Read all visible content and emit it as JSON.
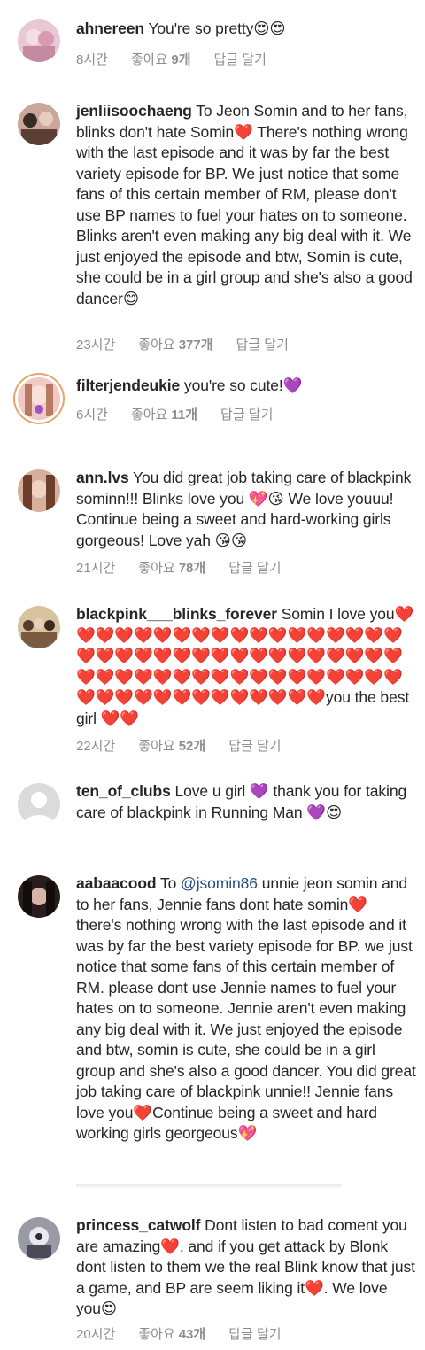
{
  "comments": [
    {
      "username": "ahnereen",
      "text": " You're so pretty😍😍",
      "time": "8시간",
      "likes_label": "좋아요",
      "likes": "9개",
      "reply": "답글 달기"
    },
    {
      "username": "jenliisoochaeng",
      "text": " To Jeon Somin and to her fans, blinks don't hate Somin❤️ There's nothing wrong with the last episode and it was by far the best variety episode for BP. We just notice that some fans of this certain member of RM, please don't use BP names to fuel your hates on to someone. Blinks aren't even making any big deal with it. We just enjoyed the episode and btw, Somin is cute, she could be in a girl group and she's also a good dancer😊",
      "time": "23시간",
      "likes_label": "좋아요",
      "likes": "377개",
      "reply": "답글 달기"
    },
    {
      "username": "filterjendeukie",
      "text": " you're so cute!💜",
      "time": "6시간",
      "likes_label": "좋아요",
      "likes": "11개",
      "reply": "답글 달기"
    },
    {
      "username": "ann.lvs",
      "text": " You did great job taking care of blackpink sominn!!! Blinks love you 💖😘 We love youuu! Continue being a sweet and hard-working girls gorgeous! Love yah 😘😘",
      "time": "21시간",
      "likes_label": "좋아요",
      "likes": "78개",
      "reply": "답글 달기"
    },
    {
      "username": "blackpink___blinks_forever",
      "text": " Somin I love you❤️❤️❤️❤️❤️❤️❤️❤️❤️❤️❤️❤️❤️❤️❤️❤️❤️❤️❤️❤️❤️❤️❤️❤️❤️❤️❤️❤️❤️❤️❤️❤️❤️❤️❤️❤️❤️❤️❤️❤️❤️❤️❤️❤️❤️❤️❤️❤️❤️❤️❤️❤️❤️❤️❤️❤️❤️❤️❤️❤️❤️❤️❤️❤️❤️you the best girl ❤️❤️",
      "time": "22시간",
      "likes_label": "좋아요",
      "likes": "52개",
      "reply": "답글 달기"
    },
    {
      "username": "ten_of_clubs",
      "text": " Love u girl 💜 thank you for taking care of blackpink in Running Man 💜😍",
      "time": "",
      "likes_label": "",
      "likes": "",
      "reply": ""
    },
    {
      "username": "aabaacood",
      "text_before": " To ",
      "mention": "@jsomin86",
      "text": " unnie jeon somin and to her fans, Jennie fans dont hate somin❤️ there's nothing wrong with the last episode and it was by far the best variety episode for BP. we just notice that some fans of this certain member of RM. please dont use Jennie names to fuel your hates on to someone. Jennie aren't even making any big deal with it. We just enjoyed the episode and btw, somin is cute, she could be in a girl group and she's also a good dancer. You did great job taking care of blackpink unnie!! Jennie fans love you❤️Continue being a sweet and hard working girls georgeous💖",
      "time": "",
      "likes_label": "",
      "likes": "",
      "reply": ""
    },
    {
      "username": "princess_catwolf",
      "text": " Dont listen to bad coment you are amazing❤️, and if you get attack by Blonk dont listen to them we the real Blink know that just a game, and BP are seem liking it❤️. We love you😍",
      "time": "20시간",
      "likes_label": "좋아요",
      "likes": "43개",
      "reply": "답글 달기"
    }
  ],
  "colors": {
    "username": "#262626",
    "meta": "#8e8e8e",
    "mention": "#2a4e82",
    "heart": "#e0202a",
    "story_ring": "#e8a46a"
  }
}
